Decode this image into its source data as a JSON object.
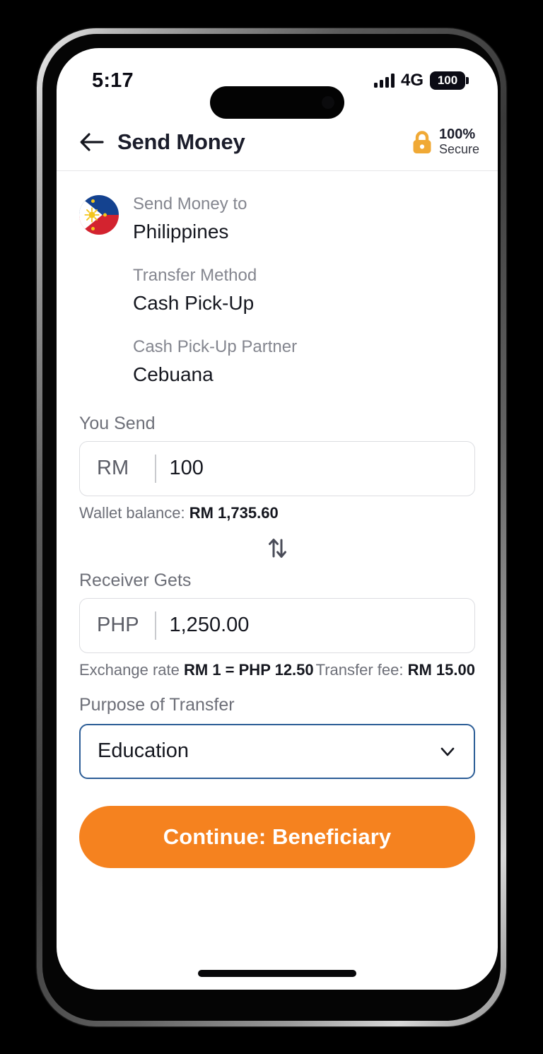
{
  "status_bar": {
    "time": "5:17",
    "network": "4G",
    "battery": "100",
    "signal_icon": "signal-bars-icon",
    "battery_icon": "battery-full-icon"
  },
  "header": {
    "back_icon": "back-arrow-icon",
    "title": "Send Money",
    "secure_icon": "lock-icon",
    "secure_percent": "100%",
    "secure_label": "Secure"
  },
  "destination": {
    "flag_icon": "philippines-flag-icon",
    "send_to_label": "Send Money to",
    "country": "Philippines",
    "transfer_method_label": "Transfer Method",
    "transfer_method": "Cash Pick-Up",
    "partner_label": "Cash Pick-Up Partner",
    "partner": "Cebuana"
  },
  "you_send": {
    "label": "You Send",
    "currency": "RM",
    "amount": "100",
    "placeholder": "0.00",
    "wallet_balance_label": "Wallet balance:",
    "wallet_balance_value": "RM 1,735.60"
  },
  "swap": {
    "icon": "swap-vertical-arrows-icon"
  },
  "receiver_gets": {
    "label": "Receiver Gets",
    "currency": "PHP",
    "amount": "1,250.00",
    "placeholder": "0.00",
    "exchange_rate_label": "Exchange rate",
    "exchange_rate_value": "RM 1 = PHP 12.50",
    "transfer_fee_label": "Transfer fee:",
    "transfer_fee_value": "RM 15.00"
  },
  "purpose": {
    "label": "Purpose of Transfer",
    "selected": "Education",
    "chevron_icon": "chevron-down-icon"
  },
  "cta": {
    "label": "Continue: Beneficiary"
  },
  "colors": {
    "accent_orange": "#f5821f",
    "secure_lock": "#f0a935",
    "focus_border": "#2c5d96",
    "muted_text": "#6d6f78",
    "primary_text": "#15171f",
    "flag_blue": "#14428f",
    "flag_red": "#d3232f",
    "flag_yellow": "#f4c51c"
  }
}
